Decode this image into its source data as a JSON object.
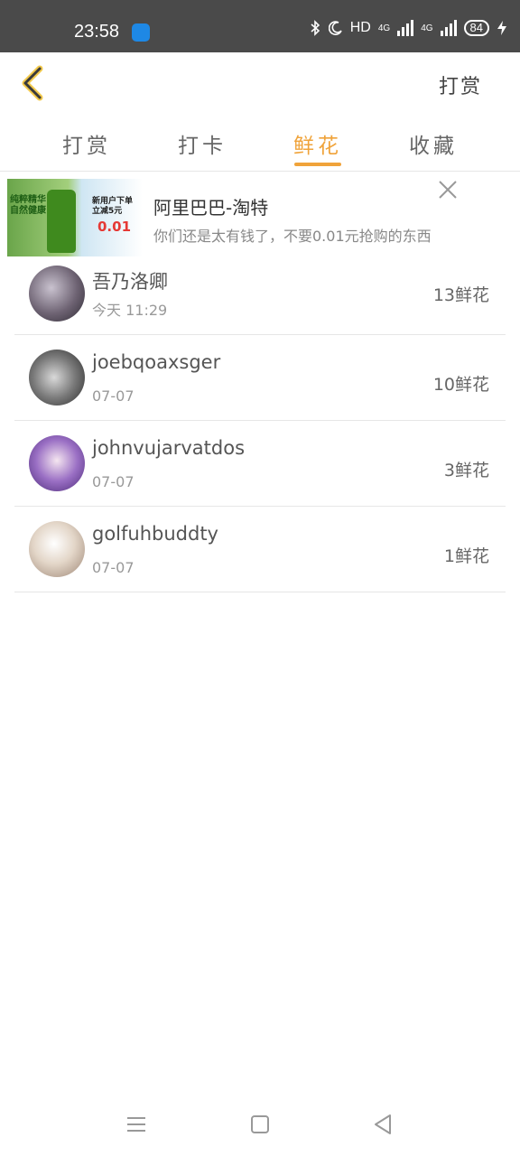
{
  "status_bar": {
    "time": "23:58",
    "indicators": "HD",
    "network_1": "4G",
    "network_2": "4G",
    "battery": "84",
    "icons": [
      "android-app-icon",
      "bluetooth-icon",
      "moon-icon",
      "signal-icon",
      "battery-icon",
      "charging-icon"
    ]
  },
  "header": {
    "back_icon": "chevron-left-icon",
    "action_label": "打赏"
  },
  "tabs": [
    {
      "label": "打赏",
      "active": false
    },
    {
      "label": "打卡",
      "active": false
    },
    {
      "label": "鲜花",
      "active": true
    },
    {
      "label": "收藏",
      "active": false
    }
  ],
  "ad": {
    "title": "阿里巴巴-淘特",
    "description": "你们还是太有钱了，不要0.01元抢购的东西",
    "image_text_1": "纯粹精华 自然健康",
    "image_text_2": "新用户下单 立减5元",
    "image_price": "0.01",
    "close_icon": "close-icon"
  },
  "list": [
    {
      "name": "吾乃洛卿",
      "date": "今天 11:29",
      "count": "13鲜花"
    },
    {
      "name": "joebqoaxsger",
      "date": "07-07",
      "count": "10鲜花"
    },
    {
      "name": "johnvujarvatdos",
      "date": "07-07",
      "count": "3鲜花"
    },
    {
      "name": "golfuhbuddty",
      "date": "07-07",
      "count": "1鲜花"
    }
  ],
  "nav_bar": {
    "icons": [
      "menu-icon",
      "home-icon",
      "back-icon"
    ]
  },
  "colors": {
    "accent": "#f0a33a",
    "status_bar_bg": "#4a4a4a"
  }
}
